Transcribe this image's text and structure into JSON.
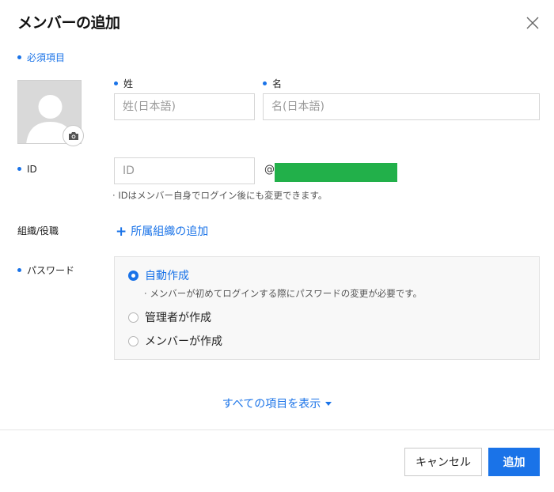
{
  "dialog": {
    "title": "メンバーの追加",
    "required_note": "必須項目"
  },
  "form": {
    "last_name": {
      "label": "姓",
      "placeholder": "姓(日本語)",
      "value": ""
    },
    "first_name": {
      "label": "名",
      "placeholder": "名(日本語)",
      "value": ""
    },
    "id": {
      "label": "ID",
      "placeholder": "ID",
      "value": "",
      "at_sign": "@",
      "hint": "IDはメンバー自身でログイン後にも変更できます。"
    },
    "org": {
      "label": "組織/役職",
      "add_label": "所属組織の追加",
      "plus": "+"
    },
    "password": {
      "label": "パスワード",
      "options": [
        {
          "label": "自動作成",
          "selected": true
        },
        {
          "label": "管理者が作成",
          "selected": false
        },
        {
          "label": "メンバーが作成",
          "selected": false
        }
      ],
      "auto_hint": "メンバーが初めてログインする際にパスワードの変更が必要です。"
    }
  },
  "show_all_label": "すべての項目を表示",
  "buttons": {
    "cancel": "キャンセル",
    "add": "追加"
  },
  "colors": {
    "accent": "#1a73e8",
    "domain_block": "#22b04a"
  },
  "icons": {
    "close": "close-icon",
    "camera": "camera-icon",
    "caret": "caret-down-icon"
  }
}
